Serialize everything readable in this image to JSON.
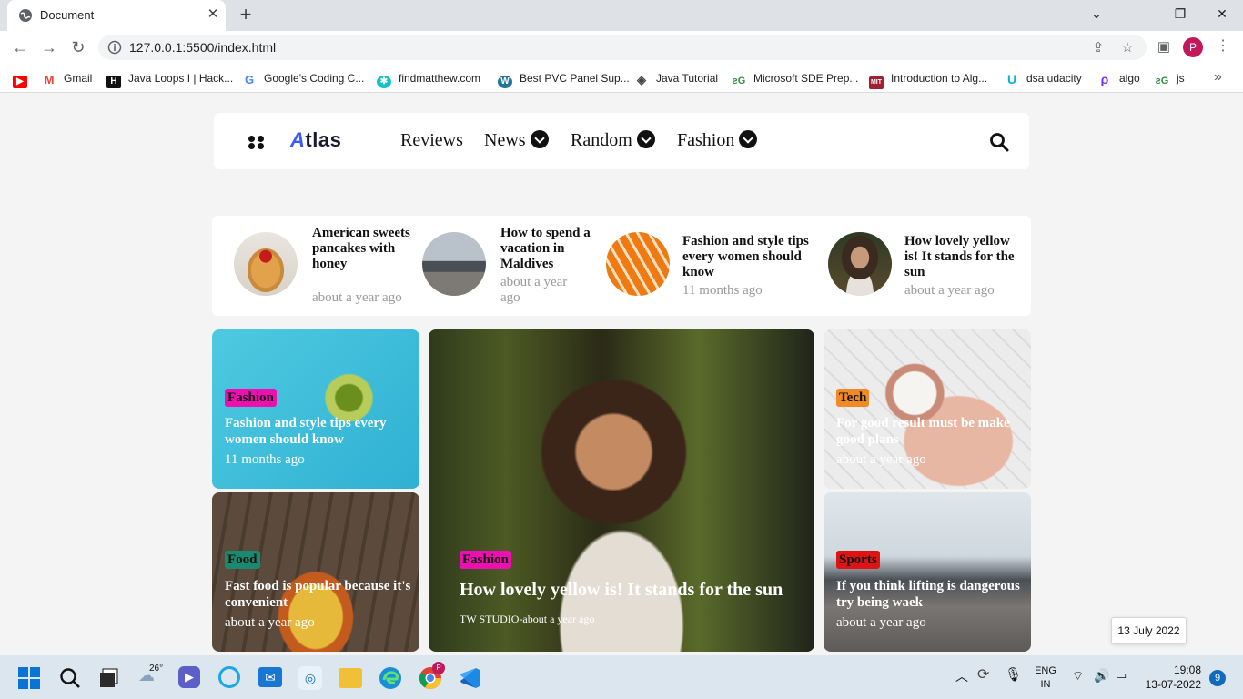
{
  "browser": {
    "tab_title": "Document",
    "new_tab": "+",
    "url": "127.0.0.1:5500/index.html",
    "profile_initial": "P"
  },
  "bookmarks": [
    {
      "label": "",
      "icon": "youtube-icon",
      "color": "#ff0000"
    },
    {
      "label": "Gmail",
      "icon": "gmail-icon",
      "color": "#ea4335"
    },
    {
      "label": "Java Loops I | Hack...",
      "icon": "hackerrank-icon",
      "color": "#111111"
    },
    {
      "label": "Google's Coding C...",
      "icon": "google-icon",
      "color": "#4285f4"
    },
    {
      "label": "findmatthew.com",
      "icon": "findmatthew-icon",
      "color": "#11c2c8"
    },
    {
      "label": "Best PVC Panel Sup...",
      "icon": "wordpress-icon",
      "color": "#21759b"
    },
    {
      "label": "Java Tutorial",
      "icon": "diamond-icon",
      "color": "#444444"
    },
    {
      "label": "Microsoft SDE Prep...",
      "icon": "geeksforgeeks-icon",
      "color": "#2f8d46"
    },
    {
      "label": "Introduction to Alg...",
      "icon": "mit-ocw-icon",
      "color": "#a31f34"
    },
    {
      "label": "dsa udacity",
      "icon": "udacity-icon",
      "color": "#02b3e4"
    },
    {
      "label": "algo",
      "icon": "algo-icon",
      "color": "#7b2ff7"
    },
    {
      "label": "js",
      "icon": "geeksforgeeks-icon",
      "color": "#2f8d46"
    }
  ],
  "site": {
    "logo": "Atlas",
    "nav": [
      {
        "label": "Reviews",
        "dropdown": false
      },
      {
        "label": "News",
        "dropdown": true
      },
      {
        "label": "Random",
        "dropdown": true
      },
      {
        "label": "Fashion",
        "dropdown": true
      }
    ]
  },
  "recent_posts": [
    {
      "title": "American sweets pancakes with honey",
      "time": "about a year ago",
      "image": "pancakes"
    },
    {
      "title": "How to spend a vacation in Maldives",
      "time": "about a year ago",
      "image": "cars"
    },
    {
      "title": "Fashion and style tips every women should know",
      "time": "11 months ago",
      "image": "orange"
    },
    {
      "title": "How lovely yellow is! It stands for the sun",
      "time": "about a year ago",
      "image": "woman"
    }
  ],
  "grid": {
    "top_left": {
      "tag": "Fashion",
      "tag_color": "#ee0fb0",
      "title": "Fashion and style tips every women should know",
      "time": "11 months ago"
    },
    "bottom_left": {
      "tag": "Food",
      "tag_color": "#1a8a6f",
      "title": "Fast food is popular because it's convenient",
      "time": "about a year ago"
    },
    "featured": {
      "tag": "Fashion",
      "tag_color": "#ee0fb0",
      "title": "How lovely yellow is! It stands for the sun",
      "byline": "TW STUDIO-about a year ago"
    },
    "top_right": {
      "tag": "Tech",
      "tag_color": "#f08a24",
      "title": "For good result must be make good plans",
      "time": "about a year ago"
    },
    "bottom_right": {
      "tag": "Sports",
      "tag_color": "#e01313",
      "title": "If you think lifting is dangerous try being waek",
      "time": "about a year ago"
    }
  },
  "date_popup": "13 July 2022",
  "taskbar": {
    "weather_temp": "26°",
    "lang_top": "ENG",
    "lang_bottom": "IN",
    "time": "19:08",
    "date": "13-07-2022",
    "notification_count": "9"
  }
}
